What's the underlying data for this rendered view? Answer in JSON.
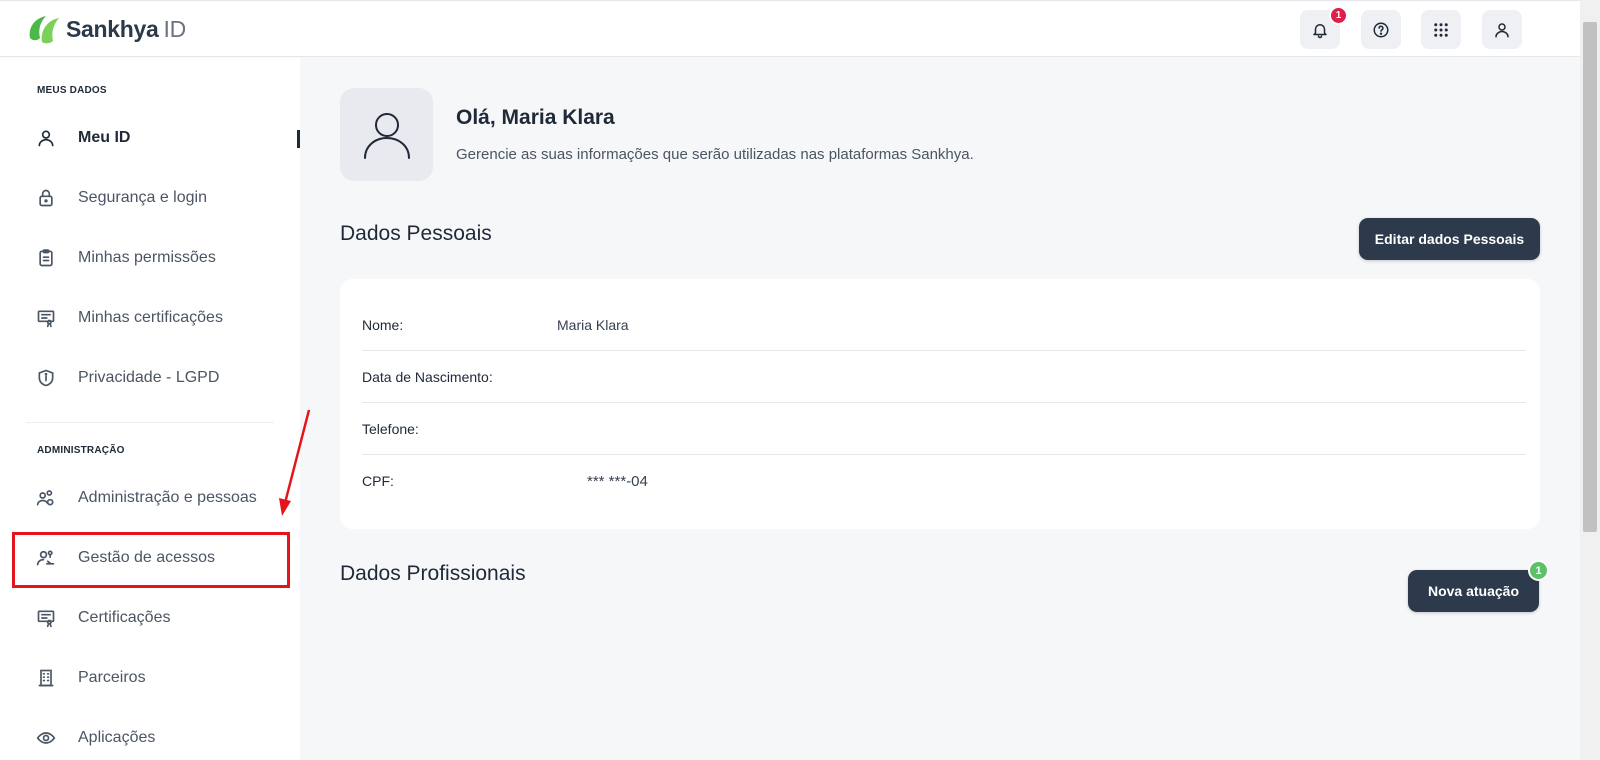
{
  "header": {
    "brand": "Sankhya",
    "brand_suffix": "ID",
    "notification_count": "1"
  },
  "sidebar": {
    "section_my_data": "MEUS DADOS",
    "section_admin": "ADMINISTRAÇÃO",
    "items": [
      {
        "label": "Meu ID",
        "icon": "user-icon",
        "active": true
      },
      {
        "label": "Segurança e login",
        "icon": "lock-icon"
      },
      {
        "label": "Minhas permissões",
        "icon": "clipboard-icon"
      },
      {
        "label": "Minhas certificações",
        "icon": "certificate-icon"
      },
      {
        "label": "Privacidade - LGPD",
        "icon": "shield-icon"
      },
      {
        "label": "Administração e pessoas",
        "icon": "people-settings-icon"
      },
      {
        "label": "Gestão de acessos",
        "icon": "user-key-icon"
      },
      {
        "label": "Certificações",
        "icon": "certificate-icon"
      },
      {
        "label": "Parceiros",
        "icon": "building-icon"
      },
      {
        "label": "Aplicações",
        "icon": "eye-icon"
      }
    ]
  },
  "main": {
    "greeting": "Olá, Maria Klara",
    "subtitle": "Gerencie as suas informações que serão utilizadas nas plataformas Sankhya.",
    "personal_title": "Dados Pessoais",
    "edit_button": "Editar dados Pessoais",
    "fields": [
      {
        "label": "Nome:",
        "value": "Maria Klara"
      },
      {
        "label": "Data de Nascimento:",
        "value": ""
      },
      {
        "label": "Telefone:",
        "value": ""
      },
      {
        "label": "CPF:",
        "value": "*** ***-04"
      }
    ],
    "professional_title": "Dados Profissionais",
    "new_button": "Nova atuação",
    "new_badge": "1"
  },
  "colors": {
    "brand_green": "#4cb848",
    "dark_button": "#2d3a4b",
    "badge_red": "#e11d48",
    "badge_green": "#5cc26a",
    "highlight_red": "#e3151a"
  }
}
